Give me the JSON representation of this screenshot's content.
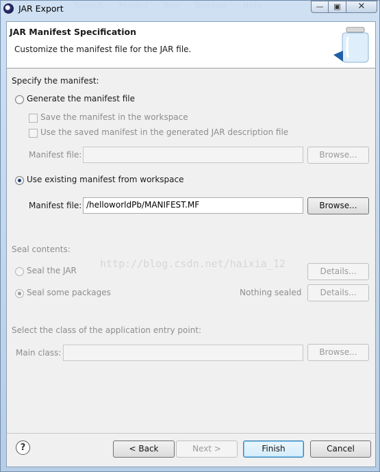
{
  "window": {
    "title": "JAR Export",
    "ghost_menu": "Search  Project  Run  Window  Help",
    "minimize_glyph": "—",
    "maximize_glyph": "▣",
    "close_glyph": "✕"
  },
  "header": {
    "title": "JAR Manifest Specification",
    "description": "Customize the manifest file for the JAR file."
  },
  "manifest": {
    "section_label": "Specify the manifest:",
    "generate_label": "Generate the manifest file",
    "save_label": "Save the manifest in the workspace",
    "use_saved_label": "Use the saved manifest in the generated JAR description file",
    "generated_file_label": "Manifest file:",
    "browse_label": "Browse...",
    "use_existing_label": "Use existing manifest from workspace",
    "existing_file_label": "Manifest file:",
    "existing_file_value": "/helloworldPb/MANIFEST.MF",
    "selected": "use_existing"
  },
  "seal": {
    "section_label": "Seal contents:",
    "seal_jar_label": "Seal the JAR",
    "seal_packages_label": "Seal some packages",
    "nothing_sealed": "Nothing sealed",
    "details_label": "Details..."
  },
  "main_class": {
    "section_label": "Select the class of the application entry point:",
    "label": "Main class:",
    "browse_label": "Browse..."
  },
  "watermark": "http://blog.csdn.net/haixia_12",
  "footer": {
    "help_glyph": "?",
    "back_label": "< Back",
    "next_label": "Next >",
    "finish_label": "Finish",
    "cancel_label": "Cancel"
  },
  "icons": {
    "app": "eclipse-icon",
    "banner": "jar-export-icon",
    "help": "help-icon"
  }
}
